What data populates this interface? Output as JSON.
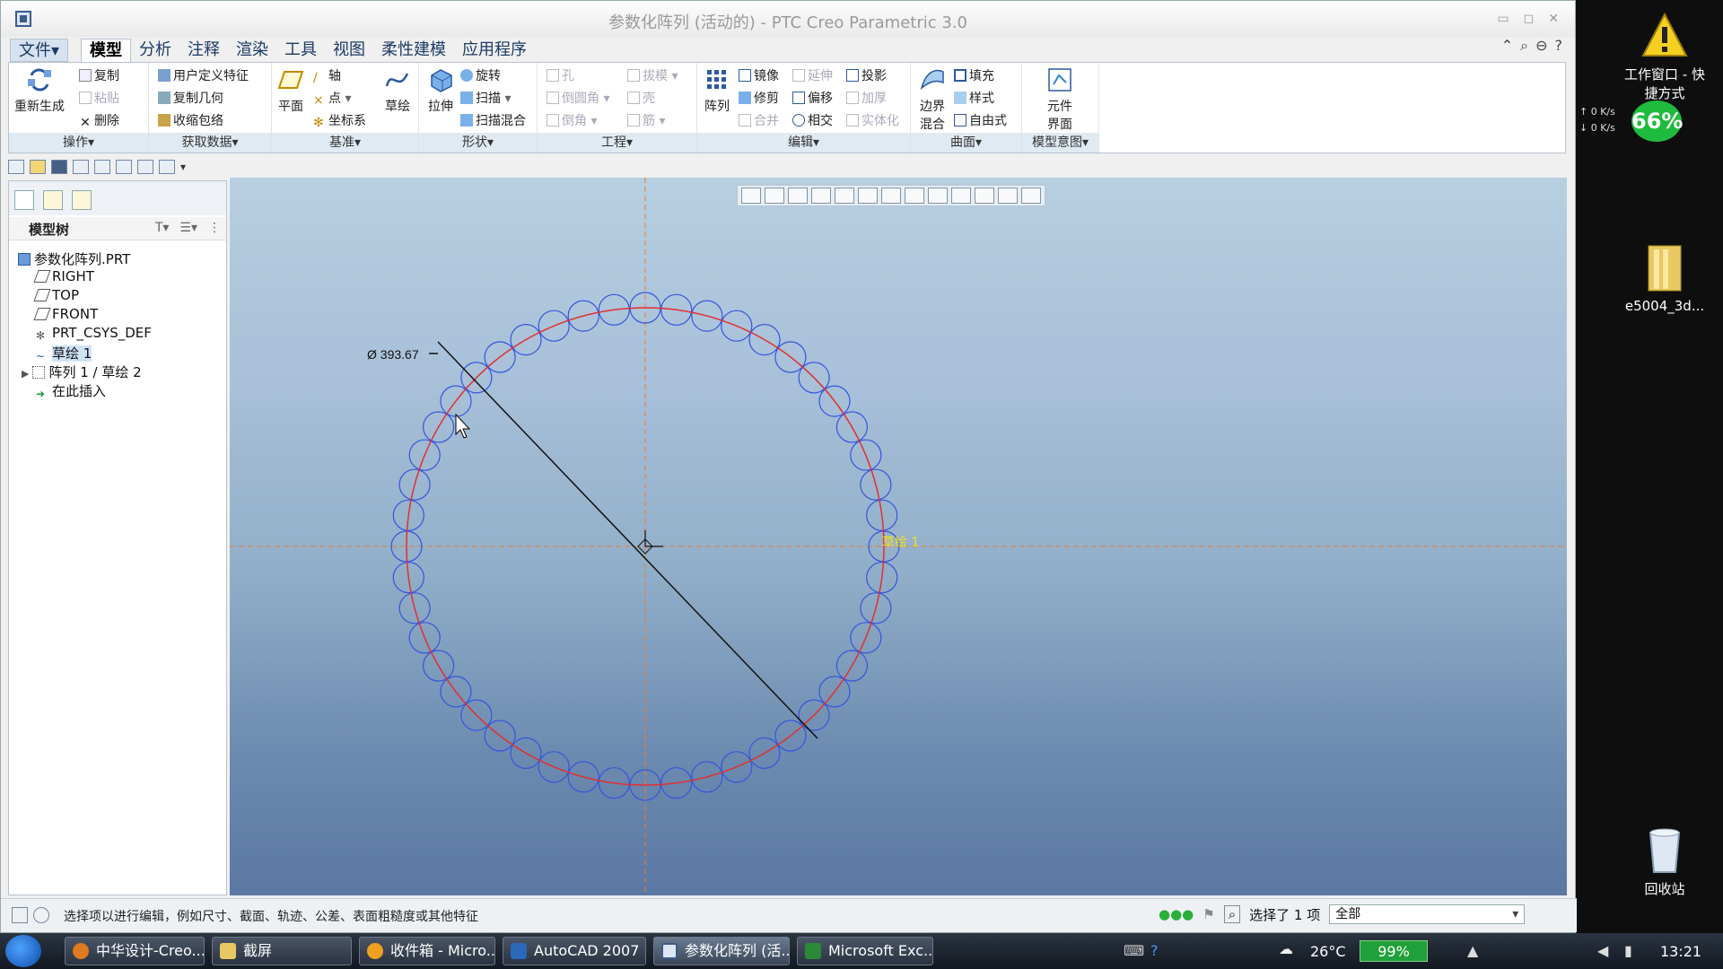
{
  "window": {
    "title": "参数化阵列 (活动的) - PTC Creo Parametric 3.0",
    "controls": [
      "▭",
      "◻",
      "✕"
    ]
  },
  "menu": {
    "tabs": [
      {
        "label": "文件▾",
        "type": "file"
      },
      {
        "label": "模型",
        "type": "active"
      },
      {
        "label": "分析"
      },
      {
        "label": "注释"
      },
      {
        "label": "渲染"
      },
      {
        "label": "工具"
      },
      {
        "label": "视图"
      },
      {
        "label": "柔性建模"
      },
      {
        "label": "应用程序"
      }
    ]
  },
  "ribbon": {
    "groups": {
      "ops": "操作▾",
      "getdata": "获取数据▾",
      "datum": "基准▾",
      "shape": "形状▾",
      "eng": "工程▾",
      "edit": "编辑▾",
      "surface": "曲面▾",
      "intent": "模型意图▾"
    },
    "regen": "重新生成",
    "copy": "复制",
    "paste": "粘贴",
    "delete": "删除",
    "udf": "用户定义特征",
    "copygeom": "复制几何",
    "shrinkwrap": "收缩包络",
    "plane": "平面",
    "axis": "轴",
    "point": "点",
    "csys": "坐标系",
    "sketch": "草绘",
    "extrude": "拉伸",
    "revolve": "旋转",
    "sweep": "扫描",
    "sweptblend": "扫描混合",
    "hole": "孔",
    "round": "倒圆角",
    "chamfer": "倒角",
    "draft": "拔模",
    "shell": "壳",
    "rib": "筋",
    "pattern": "阵列",
    "mirror": "镜像",
    "trim": "修剪",
    "merge": "合并",
    "extend": "延伸",
    "offset": "偏移",
    "intersect": "相交",
    "project": "投影",
    "thicken": "加厚",
    "solidify": "实体化",
    "boundary": [
      "边界",
      "混合"
    ],
    "fill": "填充",
    "style": "样式",
    "freestyle": "自由式",
    "component": [
      "元件",
      "界面"
    ]
  },
  "tree": {
    "title": "模型树",
    "items": [
      {
        "label": "参数化阵列.PRT"
      },
      {
        "label": "RIGHT"
      },
      {
        "label": "TOP"
      },
      {
        "label": "FRONT"
      },
      {
        "label": "PRT_CSYS_DEF"
      },
      {
        "label": "草绘 1"
      },
      {
        "label": "阵列 1 / 草绘 2"
      },
      {
        "label": "在此插入"
      }
    ]
  },
  "graphics": {
    "dimension": "Ø 393.67",
    "sketch_label": "草绘 1",
    "pattern_count": 48
  },
  "status": {
    "message": "选择项以进行编辑，例如尺寸、截面、轨迹、公差、表面粗糙度或其他特征",
    "selected": "选择了 1 项",
    "filter": "全部"
  },
  "desktop": {
    "shortcut": [
      "工作窗口 - 快",
      "捷方式"
    ],
    "folder": "e5004_3d...",
    "recycle": "回收站",
    "net_up": "↑  0 K/s",
    "net_down": "↓  0 K/s",
    "net_pct": "66%"
  },
  "taskbar": {
    "items": [
      {
        "label": "中华设计-Creo..."
      },
      {
        "label": "截屏"
      },
      {
        "label": "收件箱 - Micro..."
      },
      {
        "label": "AutoCAD 2007"
      },
      {
        "label": "参数化阵列 (活..."
      },
      {
        "label": "Microsoft Exc..."
      }
    ],
    "temperature": "26°C",
    "battery": "99%",
    "time": "13:21"
  },
  "colors": {
    "sketch_circle": "#e03030",
    "pattern_circle": "#3355dd",
    "dimension_line": "#111111",
    "sketch_label": "#f0e020",
    "center_line": "#e08040"
  }
}
